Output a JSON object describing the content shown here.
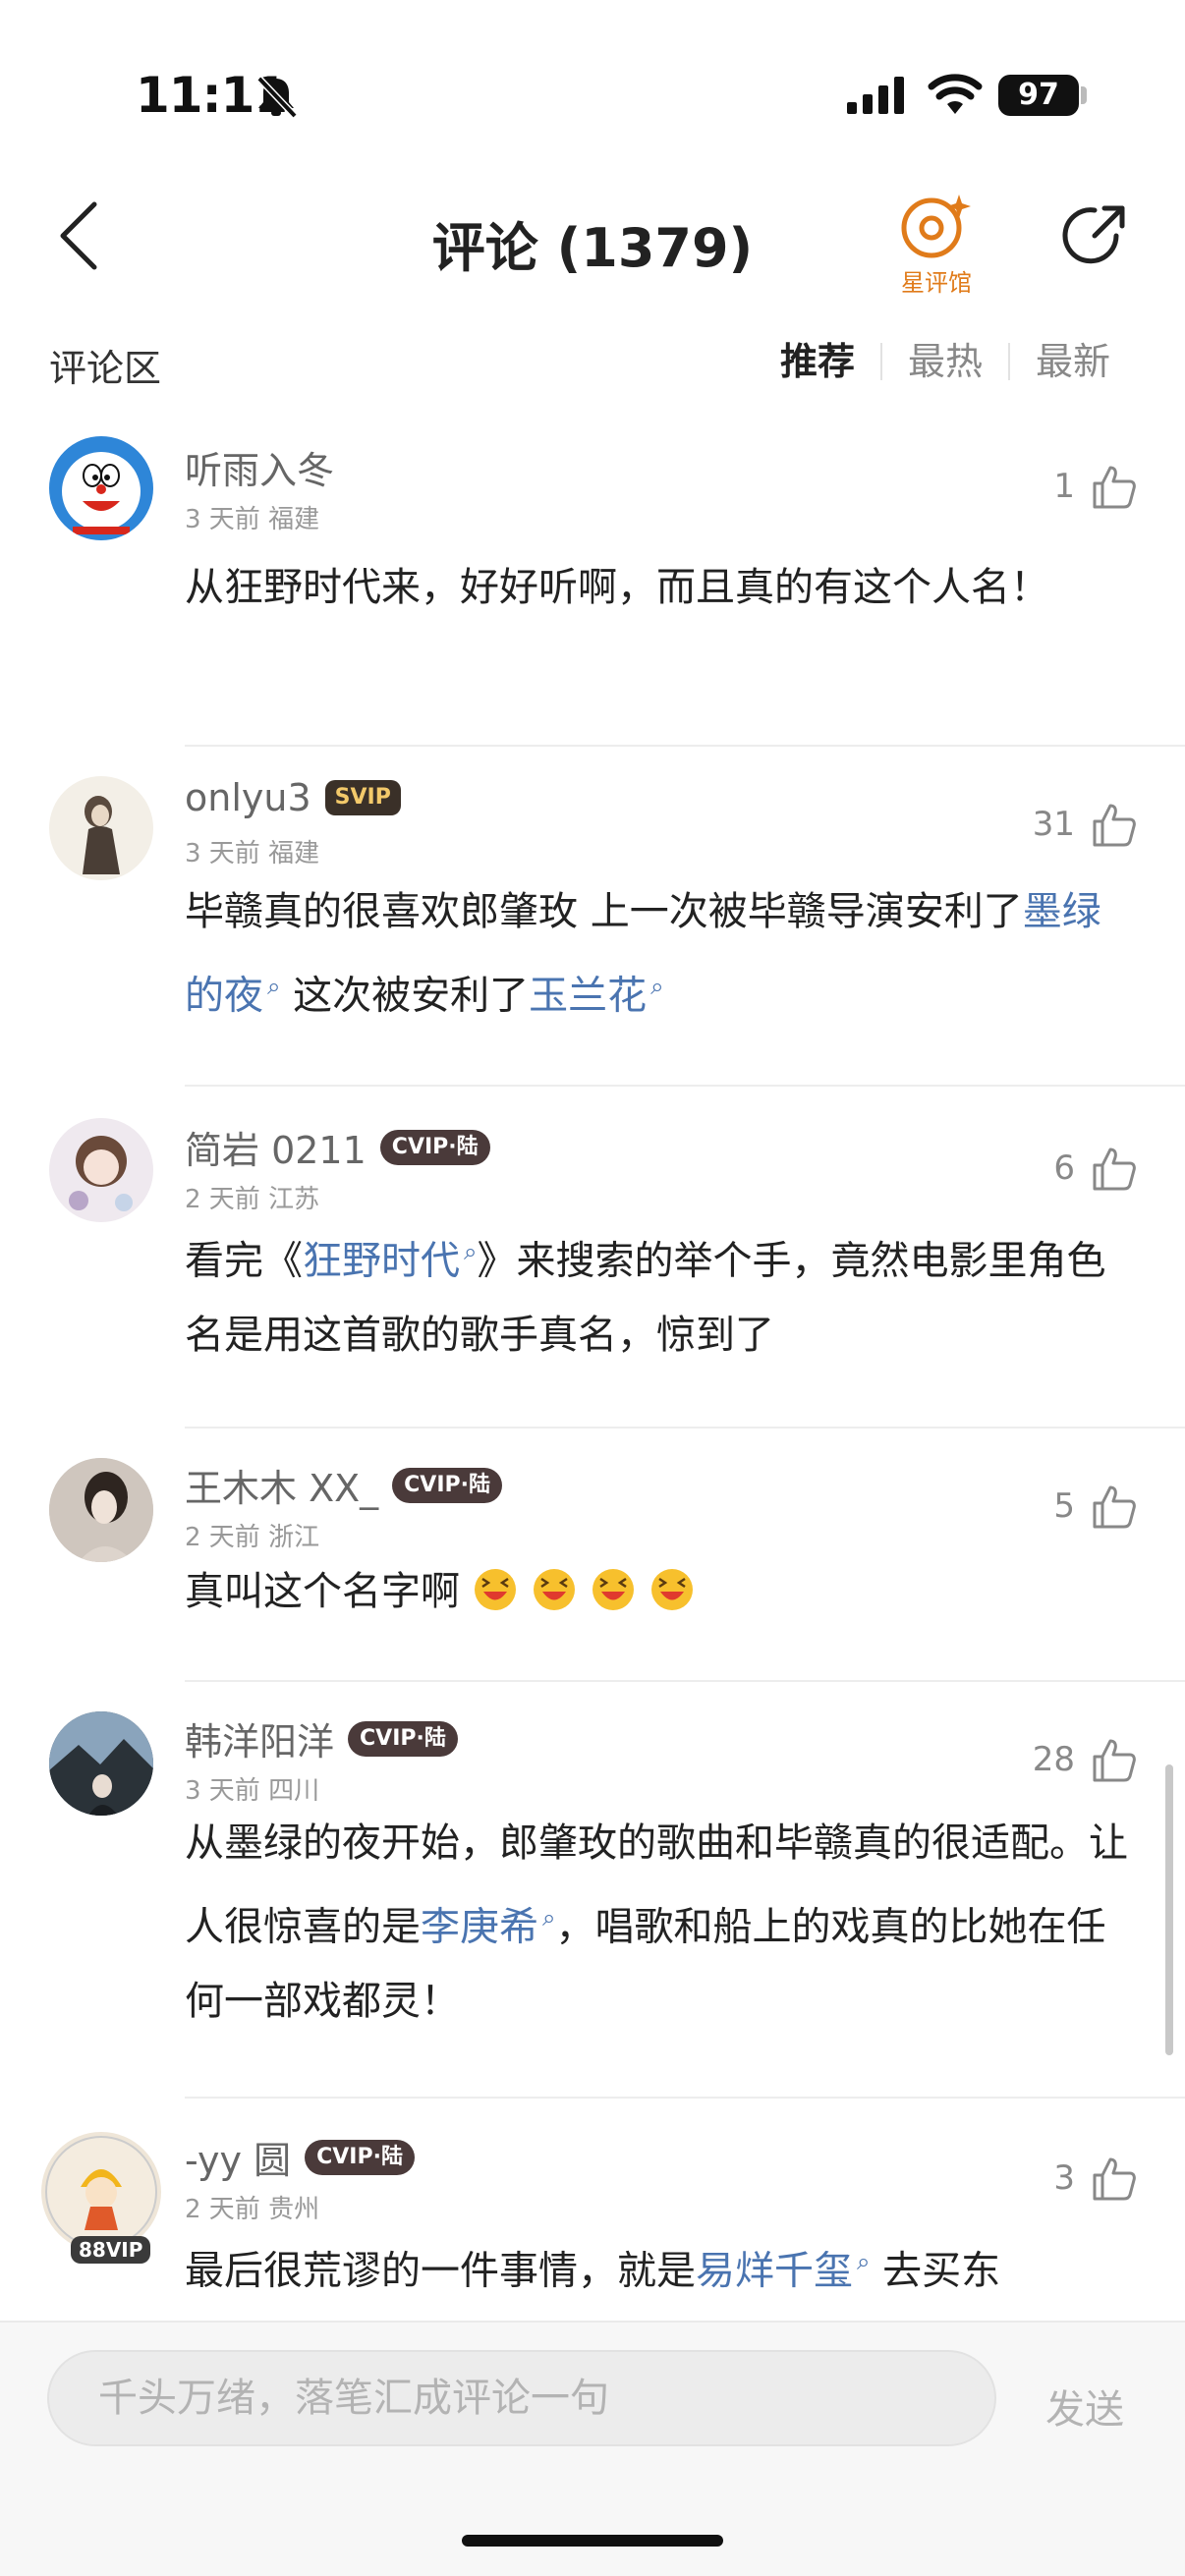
{
  "status_bar": {
    "time": "11:11",
    "battery": "97"
  },
  "header": {
    "title": "评论 (1379)",
    "star_hall_label": "星评馆"
  },
  "section": {
    "title": "评论区",
    "tabs": [
      "推荐",
      "最热",
      "最新"
    ]
  },
  "comments": [
    {
      "username": "听雨入冬",
      "badge": "",
      "time": "3 天前",
      "location": "福建",
      "likes": "1",
      "text": "从狂野时代来，好好听啊，而且真的有这个人名！"
    },
    {
      "username": "onlyu3",
      "badge": "SVIP",
      "time": "3 天前",
      "location": "福建",
      "likes": "31",
      "text_parts": [
        "毕赣真的很喜欢郎肇玫 上一次被毕赣导演安利了",
        "墨绿的夜",
        " 这次被安利了",
        "玉兰花"
      ]
    },
    {
      "username": "简岩 0211",
      "badge": "CVIP·陆",
      "time": "2 天前",
      "location": "江苏",
      "likes": "6",
      "text_parts": [
        "看完《",
        "狂野时代",
        "》来搜索的举个手，竟然电影里角色名是用这首歌的歌手真名，惊到了"
      ]
    },
    {
      "username": "王木木 XX_",
      "badge": "CVIP·陆",
      "time": "2 天前",
      "location": "浙江",
      "likes": "5",
      "text": "真叫这个名字啊"
    },
    {
      "username": "韩洋阳洋",
      "badge": "CVIP·陆",
      "time": "3 天前",
      "location": "四川",
      "likes": "28",
      "text_parts": [
        "从墨绿的夜开始，郎肇玫的歌曲和毕赣真的很适配。让人很惊喜的是",
        "李庚希",
        "，唱歌和船上的戏真的比她在任何一部戏都灵！"
      ]
    },
    {
      "username": "-yy 圆",
      "badge": "CVIP·陆",
      "time": "2 天前",
      "location": "贵州",
      "likes": "3",
      "avatar_badge": "88VIP",
      "text_parts": [
        "最后很荒谬的一件事情，就是",
        "易烊千玺",
        " 去买东"
      ]
    }
  ],
  "input": {
    "placeholder": "千头万绪，落笔汇成评论一句",
    "send_label": "发送"
  },
  "colors": {
    "link": "#4a74b0",
    "accent": "#e07b1a",
    "badge_bg": "#4a3a3a"
  }
}
